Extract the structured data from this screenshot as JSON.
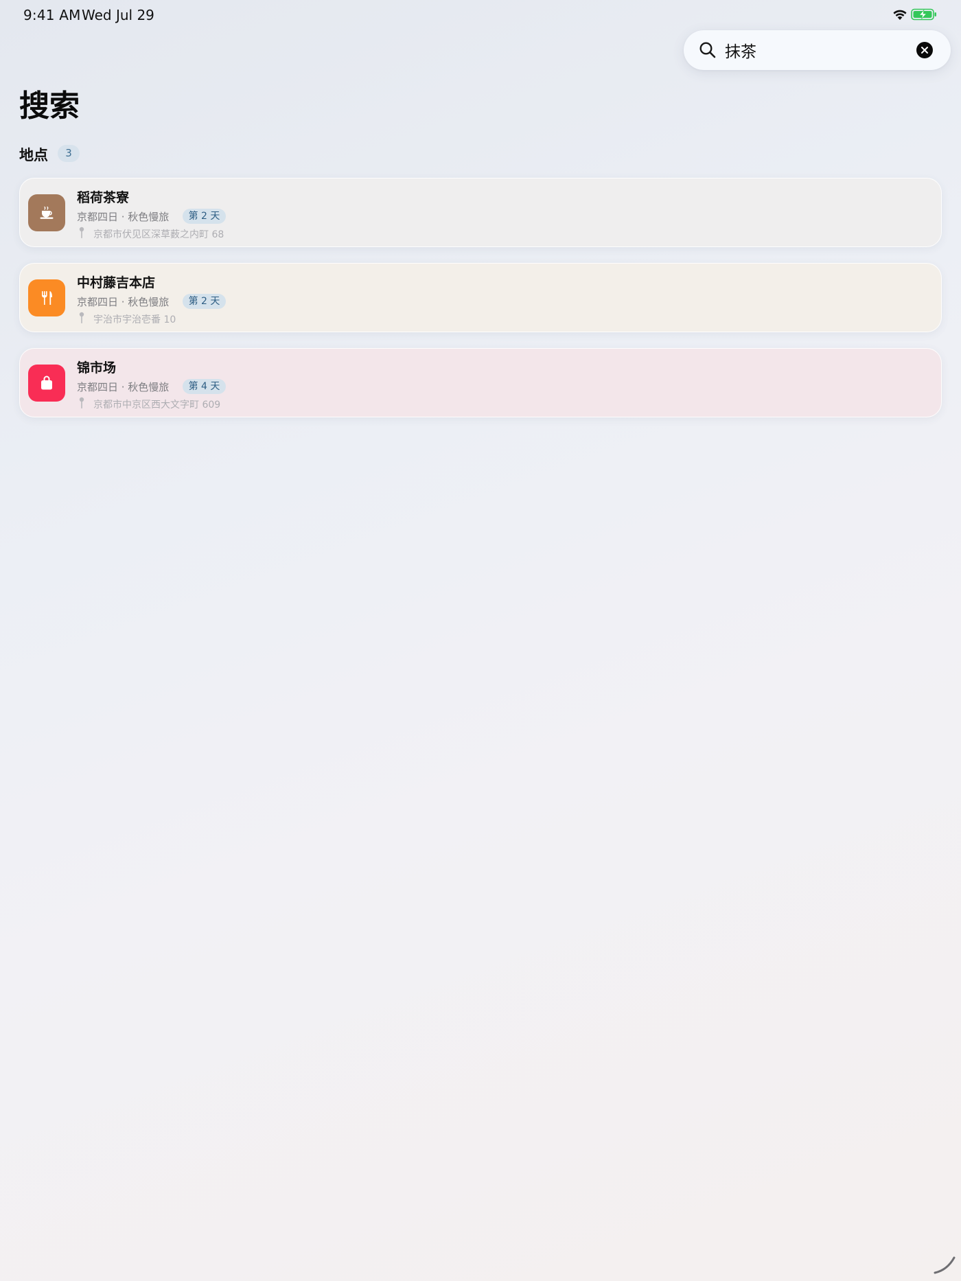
{
  "status_bar": {
    "time": "9:41 AM",
    "date": "Wed Jul 29",
    "icons": [
      "wifi-icon",
      "battery-charging-icon"
    ],
    "battery_color": "#34c759"
  },
  "search": {
    "value": "抹茶",
    "placeholder": "",
    "icon": "search-icon",
    "clear_icon": "clear-icon"
  },
  "page": {
    "title": "搜索"
  },
  "section": {
    "label": "地点",
    "count": "3"
  },
  "results": [
    {
      "name": "稻荷茶寮",
      "trip": "京都四日 · 秋色慢旅",
      "day": "第 2 天",
      "address": "京都市伏见区深草薮之内町 68",
      "icon": "cup-icon",
      "icon_color": "#a3795b"
    },
    {
      "name": "中村藤吉本店",
      "trip": "京都四日 · 秋色慢旅",
      "day": "第 2 天",
      "address": "宇治市宇治壱番 10",
      "icon": "fork-knife-icon",
      "icon_color": "#fb8b24"
    },
    {
      "name": "锦市场",
      "trip": "京都四日 · 秋色慢旅",
      "day": "第 4 天",
      "address": "京都市中京区西大文字町 609",
      "icon": "shopping-bag-icon",
      "icon_color": "#f92d55"
    }
  ],
  "colors": {
    "badge_bg": "#d5e2ec",
    "badge_text": "#2d5d83"
  }
}
